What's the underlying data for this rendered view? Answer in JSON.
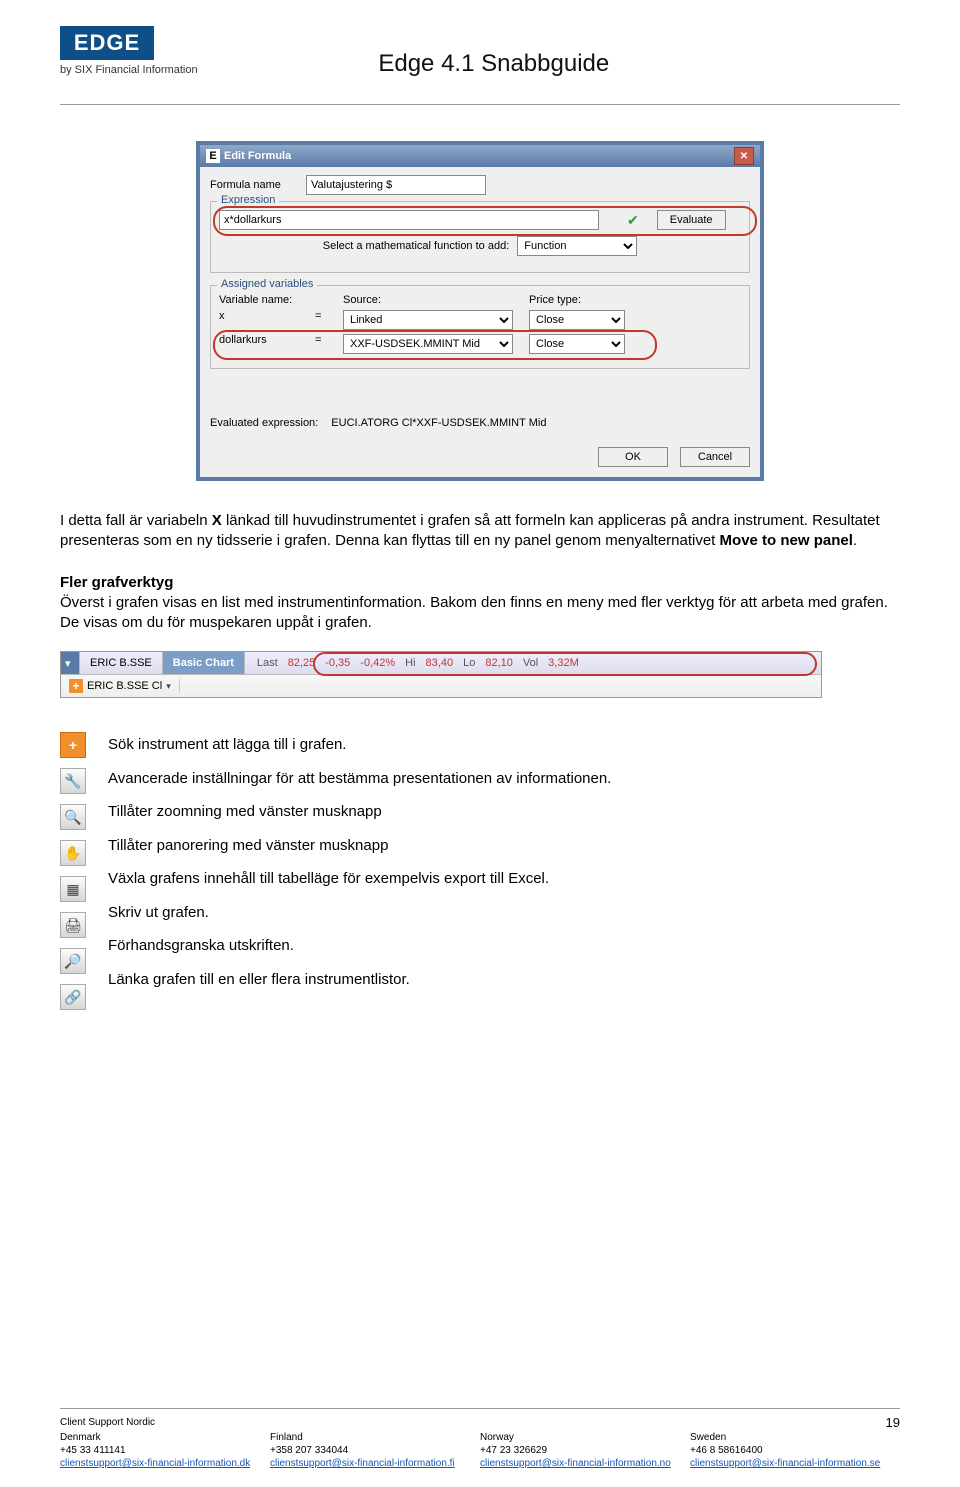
{
  "header": {
    "logo": "EDGE",
    "byline": "by SIX Financial Information",
    "doc_title": "Edge 4.1 Snabbguide"
  },
  "dialog": {
    "title": "Edit Formula",
    "icon_letter": "E",
    "formula_name_label": "Formula name",
    "formula_name_value": "Valutajustering $",
    "expression_legend": "Expression",
    "expression_value": "x*dollarkurs",
    "evaluate_label": "Evaluate",
    "function_prompt": "Select a mathematical function to add:",
    "function_select": "Function",
    "assigned_legend": "Assigned variables",
    "col_var": "Variable name:",
    "col_src": "Source:",
    "col_price": "Price type:",
    "vars": [
      {
        "name": "x",
        "source": "Linked",
        "price": "Close"
      },
      {
        "name": "dollarkurs",
        "source": "XXF-USDSEK.MMINT Mid",
        "price": "Close"
      }
    ],
    "evaluated_label": "Evaluated expression:",
    "evaluated_value": "EUCI.ATORG Cl*XXF-USDSEK.MMINT Mid",
    "ok": "OK",
    "cancel": "Cancel"
  },
  "para1_a": "I detta fall är variabeln ",
  "para1_b": "X",
  "para1_c": " länkad till huvudinstrumentet i grafen så att formeln kan appliceras på andra instrument. Resultatet presenteras som en ny tidsserie i grafen. Denna kan flyttas till en ny panel genom menyalternativet ",
  "para1_d": "Move to new panel",
  "para1_e": ".",
  "section_heading": "Fler grafverktyg",
  "para2": "Överst i grafen visas en list med instrumentinformation. Bakom den finns en meny med fler verktyg för att arbeta med grafen. De visas om du för muspekaren uppåt i grafen.",
  "chartbar": {
    "instrument": "ERIC B.SSE",
    "tab_label": "Basic Chart",
    "quote": {
      "last_l": "Last",
      "last": "82,25",
      "chg": "-0,35",
      "pct": "-0,42%",
      "hi_l": "Hi",
      "hi": "83,40",
      "lo_l": "Lo",
      "lo": "82,10",
      "vol_l": "Vol",
      "vol": "3,32M"
    },
    "add_text": "ERIC B.SSE Cl"
  },
  "tool_desc": [
    "Sök instrument att lägga till i grafen.",
    "Avancerade inställningar för att bestämma presentationen av informationen.",
    "Tillåter zoomning med vänster musknapp",
    "Tillåter panorering med vänster musknapp",
    "Växla grafens innehåll till tabelläge för exempelvis export till Excel.",
    "Skriv ut grafen.",
    "Förhandsgranska utskriften.",
    "Länka grafen till en eller flera instrumentlistor."
  ],
  "footer": {
    "support": "Client Support Nordic",
    "page": "19",
    "countries": [
      "Denmark",
      "Finland",
      "Norway",
      "Sweden"
    ],
    "phones": [
      "+45 33 411141",
      "+358 207 334044",
      "+47 23 326629",
      "+46 8 58616400"
    ],
    "emails": [
      "clienstsupport@six-financial-information.dk",
      "clienstsupport@six-financial-information.fi",
      "clienstsupport@six-financial-information.no",
      "clienstsupport@six-financial-information.se"
    ]
  }
}
